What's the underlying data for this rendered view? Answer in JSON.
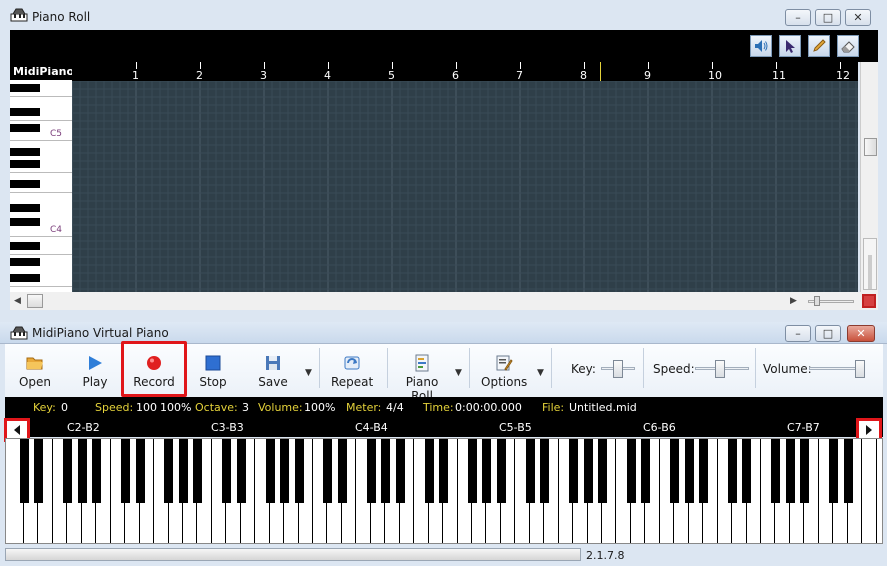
{
  "piano_roll": {
    "title": "Piano Roll",
    "tools": [
      "speaker-icon",
      "pointer-icon",
      "pencil-icon",
      "eraser-icon"
    ],
    "keyboard_header": "MidiPiano",
    "note_labels": [
      "C5",
      "C4"
    ],
    "ruler_numbers": [
      "1",
      "2",
      "3",
      "4",
      "5",
      "6",
      "7",
      "8",
      "9",
      "10",
      "11",
      "12"
    ],
    "grid_color": "#2f3f49"
  },
  "virtual_piano": {
    "title": "MidiPiano Virtual Piano",
    "toolbar": {
      "open": "Open",
      "play": "Play",
      "record": "Record",
      "stop": "Stop",
      "save": "Save",
      "repeat": "Repeat",
      "piano_roll": "Piano Roll",
      "options": "Options",
      "key_label": "Key:",
      "speed_label": "Speed:",
      "volume_label": "Volume:"
    },
    "status": {
      "key_label": "Key:",
      "key_value": "0",
      "speed_label": "Speed:",
      "speed_value": "100",
      "speed_pct": "100%",
      "octave_label": "Octave:",
      "octave_value": "3",
      "volume_label": "Volume:",
      "volume_value": "100%",
      "meter_label": "Meter:",
      "meter_value": "4/4",
      "time_label": "Time:",
      "time_value": "0:00:00.000",
      "file_label": "File:",
      "file_value": "Untitled.mid"
    },
    "octaves": [
      "C2-B2",
      "C3-B3",
      "C4-B4",
      "C5-B5",
      "C6-B6",
      "C7-B7"
    ],
    "version": "2.1.7.8",
    "highlight_color": "#e0161a",
    "status_label_color": "#e4d23a"
  }
}
